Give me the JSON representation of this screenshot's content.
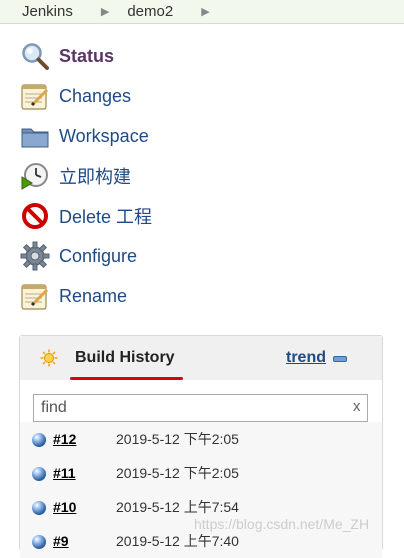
{
  "breadcrumb": {
    "items": [
      {
        "label": "Jenkins"
      },
      {
        "label": "demo2"
      }
    ]
  },
  "menu": {
    "items": [
      {
        "label": "Status",
        "icon": "search-icon"
      },
      {
        "label": "Changes",
        "icon": "notepad-icon"
      },
      {
        "label": "Workspace",
        "icon": "folder-icon"
      },
      {
        "label": "立即构建",
        "icon": "clock-play-icon"
      },
      {
        "label": "Delete 工程",
        "icon": "no-entry-icon"
      },
      {
        "label": "Configure",
        "icon": "gear-icon"
      },
      {
        "label": "Rename",
        "icon": "notepad-icon"
      }
    ]
  },
  "build_history": {
    "title": "Build History",
    "trend_label": "trend",
    "filter": {
      "placeholder": "find",
      "value": "",
      "clear_label": "x"
    },
    "builds": [
      {
        "number": "#12",
        "date": "2019-5-12 下午2:05",
        "status_color": "#3465a4"
      },
      {
        "number": "#11",
        "date": "2019-5-12 下午2:05",
        "status_color": "#3465a4"
      },
      {
        "number": "#10",
        "date": "2019-5-12 上午7:54",
        "status_color": "#3465a4"
      },
      {
        "number": "#9",
        "date": "2019-5-12 上午7:40",
        "status_color": "#3465a4"
      }
    ]
  },
  "watermark": "https://blog.csdn.net/Me_ZH",
  "colors": {
    "accent_underline": "#d9000f",
    "link": "#204a87",
    "status_link": "#5c3566"
  }
}
